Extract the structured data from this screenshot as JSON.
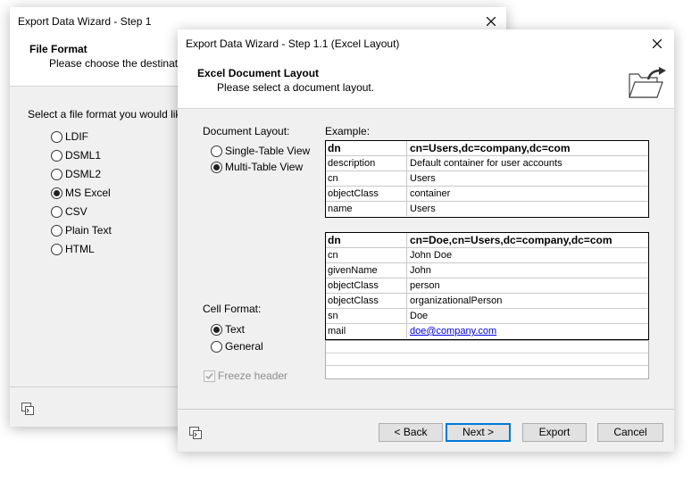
{
  "back_window": {
    "title": "Export Data Wizard - Step 1",
    "header_title": "File Format",
    "header_subtitle": "Please choose the destination",
    "prompt": "Select a file format you would like t",
    "formats": [
      {
        "label": "LDIF",
        "checked": false
      },
      {
        "label": "DSML1",
        "checked": false
      },
      {
        "label": "DSML2",
        "checked": false
      },
      {
        "label": "MS Excel",
        "checked": true
      },
      {
        "label": "CSV",
        "checked": false
      },
      {
        "label": "Plain Text",
        "checked": false
      },
      {
        "label": "HTML",
        "checked": false
      }
    ]
  },
  "front_window": {
    "title": "Export Data Wizard - Step 1.1 (Excel Layout)",
    "header_title": "Excel Document Layout",
    "header_subtitle": "Please select a document layout.",
    "document_layout_label": "Document Layout:",
    "layouts": [
      {
        "label": "Single-Table View",
        "checked": false
      },
      {
        "label": "Multi-Table View",
        "checked": true
      }
    ],
    "cell_format_label": "Cell Format:",
    "cell_formats": [
      {
        "label": "Text",
        "checked": true
      },
      {
        "label": "General",
        "checked": false
      }
    ],
    "freeze_header": "Freeze header",
    "example_label": "Example:",
    "table1": {
      "head": [
        "dn",
        "cn=Users,dc=company,dc=com"
      ],
      "rows": [
        [
          "description",
          "Default container for user accounts"
        ],
        [
          "cn",
          "Users"
        ],
        [
          "objectClass",
          "container"
        ],
        [
          "name",
          "Users"
        ]
      ]
    },
    "table2": {
      "head": [
        "dn",
        "cn=Doe,cn=Users,dc=company,dc=com"
      ],
      "rows": [
        [
          "cn",
          "John Doe"
        ],
        [
          "givenName",
          "John"
        ],
        [
          "objectClass",
          "person"
        ],
        [
          "objectClass",
          "organizationalPerson"
        ],
        [
          "sn",
          "Doe"
        ],
        [
          "mail",
          "doe@company.com"
        ]
      ]
    },
    "buttons": {
      "back": "< Back",
      "next": "Next >",
      "export": "Export",
      "cancel": "Cancel"
    }
  },
  "colors": {
    "accent": "#0078d7",
    "link": "#0000ee"
  }
}
